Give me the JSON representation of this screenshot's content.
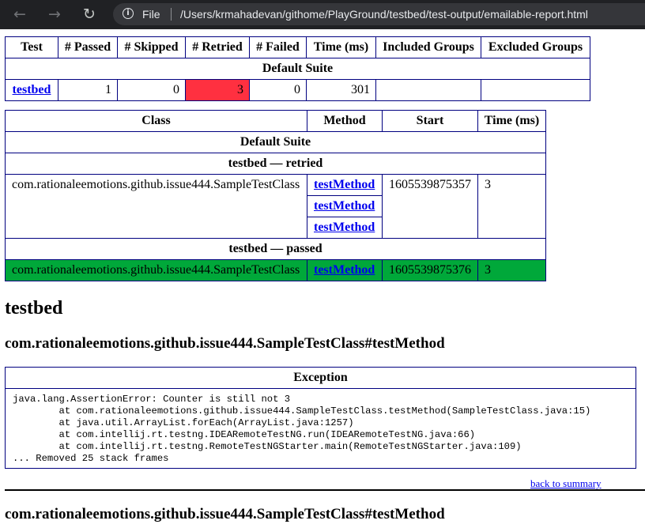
{
  "browser": {
    "info_icon": "info-icon",
    "scheme": "File",
    "url": "/Users/krmahadevan/githome/PlayGround/testbed/test-output/emailable-report.html",
    "back_icon": "arrow-left-icon",
    "forward_icon": "arrow-right-icon",
    "reload_icon": "reload-icon"
  },
  "summary": {
    "headers": [
      "Test",
      "# Passed",
      "# Skipped",
      "# Retried",
      "# Failed",
      "Time (ms)",
      "Included Groups",
      "Excluded Groups"
    ],
    "suite": "Default Suite",
    "row": {
      "test": "testbed",
      "passed": "1",
      "skipped": "0",
      "retried": "3",
      "failed": "0",
      "time": "301",
      "included": "",
      "excluded": ""
    },
    "retried_color": "#ff3040"
  },
  "methods": {
    "headers": [
      "Class",
      "Method",
      "Start",
      "Time (ms)"
    ],
    "suite": "Default Suite",
    "retried_group": "testbed — retried",
    "retried_row": {
      "class": "com.rationaleemotions.github.issue444.SampleTestClass",
      "methods": [
        "testMethod",
        "testMethod",
        "testMethod"
      ],
      "start": "1605539875357",
      "time": "3"
    },
    "passed_group": "testbed — passed",
    "passed_row": {
      "class": "com.rationaleemotions.github.issue444.SampleTestClass",
      "method": "testMethod",
      "start": "1605539875376",
      "time": "3"
    },
    "passed_color": "#00a83a"
  },
  "details": {
    "test_heading": "testbed",
    "method_heading": "com.rationaleemotions.github.issue444.SampleTestClass#testMethod",
    "exception_header": "Exception",
    "stack": [
      "java.lang.AssertionError: Counter is still not 3",
      "        at com.rationaleemotions.github.issue444.SampleTestClass.testMethod(SampleTestClass.java:15)",
      "        at java.util.ArrayList.forEach(ArrayList.java:1257)",
      "        at com.intellij.rt.testng.IDEARemoteTestNG.run(IDEARemoteTestNG.java:66)",
      "        at com.intellij.rt.testng.RemoteTestNGStarter.main(RemoteTestNGStarter.java:109)",
      "... Removed 25 stack frames"
    ],
    "back_link": "back to summary",
    "method_heading_2": "com.rationaleemotions.github.issue444.SampleTestClass#testMethod"
  }
}
